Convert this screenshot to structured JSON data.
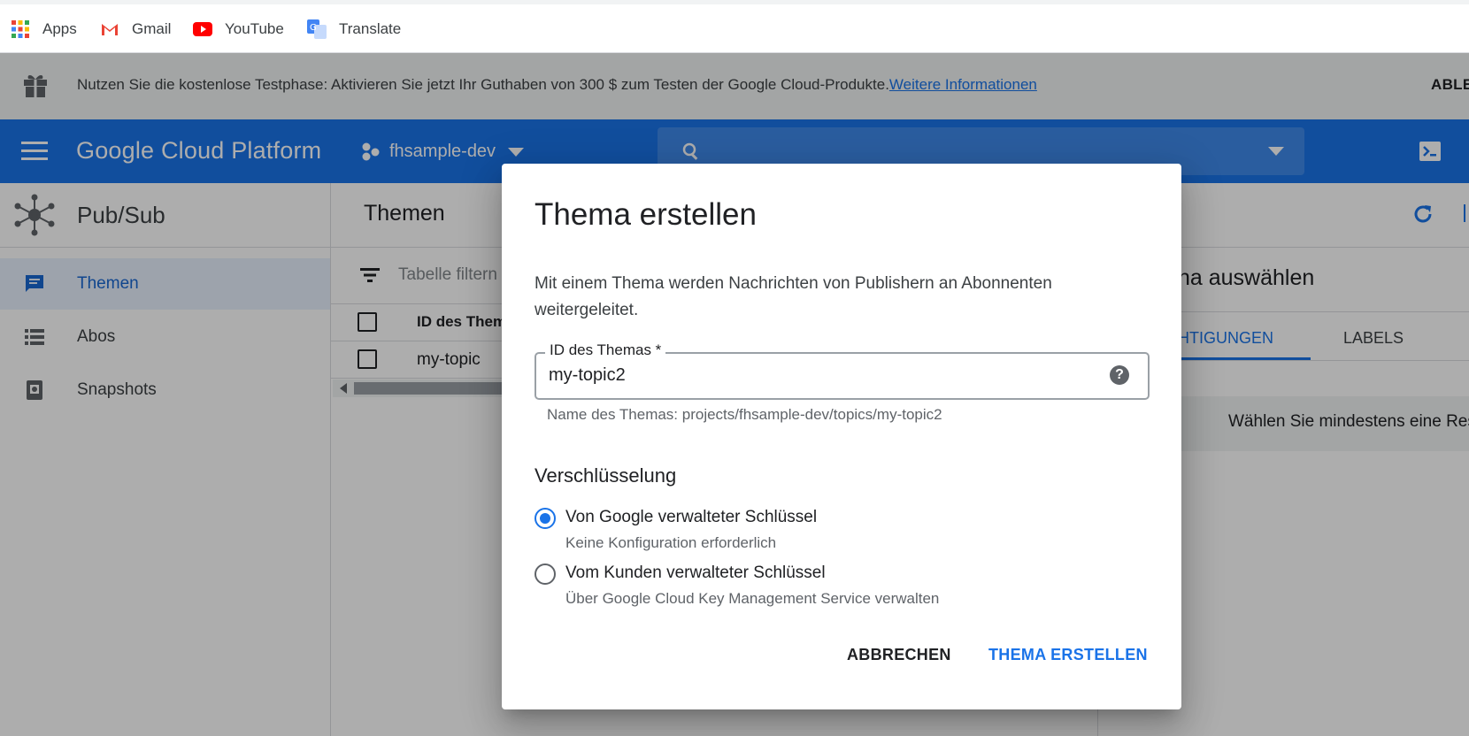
{
  "bookmarks": {
    "items": [
      {
        "label": "Apps",
        "icon": "apps-grid-icon"
      },
      {
        "label": "Gmail",
        "icon": "gmail-icon"
      },
      {
        "label": "YouTube",
        "icon": "youtube-icon"
      },
      {
        "label": "Translate",
        "icon": "translate-icon"
      }
    ]
  },
  "promo": {
    "text": "Nutzen Sie die kostenlose Testphase: Aktivieren Sie jetzt Ihr Guthaben von 300 $ zum Testen der Google Cloud-Produkte.",
    "link": "Weitere Informationen",
    "dismiss": "ABLE"
  },
  "header": {
    "brand": "Google Cloud Platform",
    "project": "fhsample-dev"
  },
  "leftnav": {
    "product": "Pub/Sub",
    "items": [
      {
        "label": "Themen",
        "active": true
      },
      {
        "label": "Abos",
        "active": false
      },
      {
        "label": "Snapshots",
        "active": false
      }
    ]
  },
  "main": {
    "title": "Themen",
    "filter_placeholder": "Tabelle filtern",
    "table": {
      "header": "ID des Them",
      "rows": [
        "my-topic"
      ]
    }
  },
  "sidepanel": {
    "title_fragment": "na auswählen",
    "tabs": [
      "HTIGUNGEN",
      "LABELS"
    ],
    "message": "Wählen Sie mindestens eine Res"
  },
  "dialog": {
    "title": "Thema erstellen",
    "description": "Mit einem Thema werden Nachrichten von Publishern an Abonnenten weitergeleitet.",
    "field": {
      "label": "ID des Themas *",
      "value": "my-topic2",
      "hint": "Name des Themas: projects/fhsample-dev/topics/my-topic2"
    },
    "encryption": {
      "title": "Verschlüsselung",
      "options": [
        {
          "label": "Von Google verwalteter Schlüssel",
          "sub": "Keine Konfiguration erforderlich",
          "checked": true
        },
        {
          "label": "Vom Kunden verwalteter Schlüssel",
          "sub": "Über Google Cloud Key Management Service verwalten",
          "checked": false
        }
      ]
    },
    "cancel_label": "ABBRECHEN",
    "submit_label": "THEMA ERSTELLEN"
  },
  "colors": {
    "primary": "#1a73e8",
    "scrim": "rgba(0,0,0,0.32)",
    "active_nav_bg": "#e8f0fe"
  }
}
